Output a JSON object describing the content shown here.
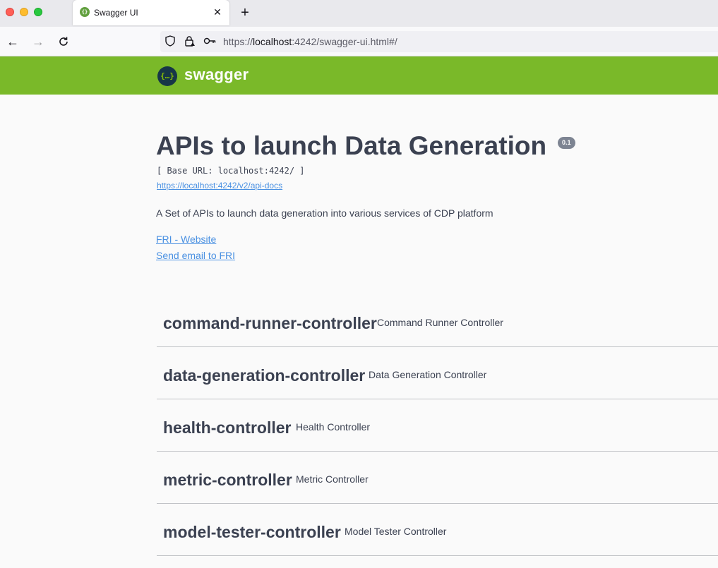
{
  "browser": {
    "tab_title": "Swagger UI",
    "tab_close": "✕",
    "new_tab": "+",
    "url_prefix": "https://",
    "url_host": "localhost",
    "url_rest": ":4242/swagger-ui.html#/"
  },
  "topbar": {
    "logo_mark": "{…}",
    "logo_text": "swagger"
  },
  "info": {
    "title": "APIs to launch Data Generation",
    "version": "0.1",
    "base_url": "[ Base URL: localhost:4242/ ]",
    "api_docs_link": "https://localhost:4242/v2/api-docs",
    "description": "A Set of APIs to launch data generation into various services of CDP platform",
    "website_link": "FRI - Website",
    "email_link": "Send email to FRI"
  },
  "tags": [
    {
      "name": "command-runner-controller",
      "description": "Command Runner Controller"
    },
    {
      "name": "data-generation-controller",
      "description": "Data Generation Controller"
    },
    {
      "name": "health-controller",
      "description": "Health Controller"
    },
    {
      "name": "metric-controller",
      "description": "Metric Controller"
    },
    {
      "name": "model-tester-controller",
      "description": "Model Tester Controller"
    }
  ]
}
